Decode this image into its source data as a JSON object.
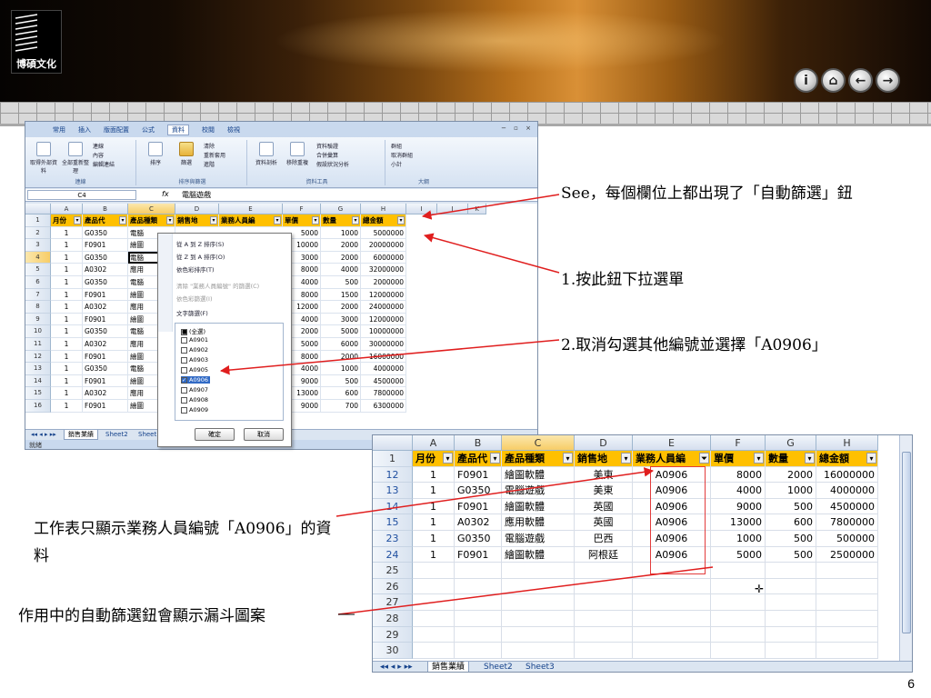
{
  "logo": {
    "text": "博碩文化"
  },
  "nav_buttons": [
    {
      "name": "info-button",
      "glyph": "i"
    },
    {
      "name": "home-button",
      "glyph": "⌂"
    },
    {
      "name": "back-button",
      "glyph": "←"
    },
    {
      "name": "forward-button",
      "glyph": "→"
    }
  ],
  "excel1": {
    "ribbon_tabs": [
      "常用",
      "插入",
      "版面配置",
      "公式",
      "資料",
      "校閱",
      "檢視"
    ],
    "active_tab": "資料",
    "ribbon_groups": [
      {
        "label": "連線",
        "buttons": [
          "取得外部資料",
          "全部重新整理",
          "連線",
          "內容",
          "編輯連結"
        ]
      },
      {
        "label": "排序與篩選",
        "buttons": [
          "排序",
          "篩選",
          "清除",
          "重新套用",
          "進階"
        ]
      },
      {
        "label": "資料工具",
        "buttons": [
          "資料剖析",
          "移除重複",
          "資料驗證",
          "合併彙算",
          "假設狀況分析"
        ]
      },
      {
        "label": "大綱",
        "buttons": [
          "群組",
          "取消群組",
          "小計"
        ]
      }
    ],
    "name_box": "C4",
    "formula_value": "電腦遊戲",
    "columns": [
      "A",
      "B",
      "C",
      "D",
      "E",
      "F",
      "G",
      "H",
      "I",
      "J",
      "K"
    ],
    "header_row": [
      "月份",
      "產品代",
      "產品種類",
      "銷售地",
      "業務人員編",
      "單價",
      "數量",
      "總金額"
    ],
    "rows": [
      {
        "n": "2",
        "a": "1",
        "b": "G0350",
        "c": "電腦",
        "f": "5000",
        "g": "1000",
        "h": "5000000"
      },
      {
        "n": "3",
        "a": "1",
        "b": "F0901",
        "c": "繪圖",
        "f": "10000",
        "g": "2000",
        "h": "20000000"
      },
      {
        "n": "4",
        "a": "1",
        "b": "G0350",
        "c": "電腦",
        "f": "3000",
        "g": "2000",
        "h": "6000000"
      },
      {
        "n": "5",
        "a": "1",
        "b": "A0302",
        "c": "應用",
        "f": "8000",
        "g": "4000",
        "h": "32000000"
      },
      {
        "n": "6",
        "a": "1",
        "b": "G0350",
        "c": "電腦",
        "f": "4000",
        "g": "500",
        "h": "2000000"
      },
      {
        "n": "7",
        "a": "1",
        "b": "F0901",
        "c": "繪圖",
        "f": "8000",
        "g": "1500",
        "h": "12000000"
      },
      {
        "n": "8",
        "a": "1",
        "b": "A0302",
        "c": "應用",
        "f": "12000",
        "g": "2000",
        "h": "24000000"
      },
      {
        "n": "9",
        "a": "1",
        "b": "F0901",
        "c": "繪圖",
        "f": "4000",
        "g": "3000",
        "h": "12000000"
      },
      {
        "n": "10",
        "a": "1",
        "b": "G0350",
        "c": "電腦",
        "f": "2000",
        "g": "5000",
        "h": "10000000"
      },
      {
        "n": "11",
        "a": "1",
        "b": "A0302",
        "c": "應用",
        "f": "5000",
        "g": "6000",
        "h": "30000000"
      },
      {
        "n": "12",
        "a": "1",
        "b": "F0901",
        "c": "繪圖",
        "f": "8000",
        "g": "2000",
        "h": "16000000"
      },
      {
        "n": "13",
        "a": "1",
        "b": "G0350",
        "c": "電腦",
        "f": "4000",
        "g": "1000",
        "h": "4000000"
      },
      {
        "n": "14",
        "a": "1",
        "b": "F0901",
        "c": "繪圖",
        "f": "9000",
        "g": "500",
        "h": "4500000"
      },
      {
        "n": "15",
        "a": "1",
        "b": "A0302",
        "c": "應用",
        "f": "13000",
        "g": "600",
        "h": "7800000"
      },
      {
        "n": "16",
        "a": "1",
        "b": "F0901",
        "c": "繪圖",
        "f": "9000",
        "g": "700",
        "h": "6300000"
      }
    ],
    "dropdown": {
      "sort_asc": "從 A 到 Z 排序(S)",
      "sort_desc": "從 Z 到 A 排序(O)",
      "sort_color": "依色彩排序(T)",
      "clear_filter": "清除 \"業務人員編號\" 的篩選(C)",
      "filter_color": "依色彩篩選(I)",
      "text_filter": "文字篩選(F)",
      "options": [
        {
          "label": "(全選)",
          "state": "partial"
        },
        {
          "label": "A0901",
          "state": "off"
        },
        {
          "label": "A0902",
          "state": "off"
        },
        {
          "label": "A0903",
          "state": "off"
        },
        {
          "label": "A0905",
          "state": "off"
        },
        {
          "label": "A0906",
          "state": "on"
        },
        {
          "label": "A0907",
          "state": "off"
        },
        {
          "label": "A0908",
          "state": "off"
        },
        {
          "label": "A0909",
          "state": "off"
        }
      ],
      "ok": "確定",
      "cancel": "取消"
    },
    "sheet_tabs": [
      "銷售業績",
      "Sheet2",
      "Sheet"
    ],
    "status": "就緒"
  },
  "annotations": {
    "see": "See，每個欄位上都出現了「自動篩選」鈕",
    "step1": "1.按此鈕下拉選單",
    "step2": "2.取消勾選其他編號並選擇「A0906」",
    "result": "工作表只顯示業務人員編號「A0906」的資料",
    "funnel": "作用中的自動篩選鈕會顯示漏斗圖案"
  },
  "excel2": {
    "columns": [
      "A",
      "B",
      "C",
      "D",
      "E",
      "F",
      "G",
      "H"
    ],
    "header_row": [
      "月份",
      "產品代",
      "產品種類",
      "銷售地",
      "業務人員編",
      "單價",
      "數量",
      "總金額"
    ],
    "rows": [
      {
        "n": "12",
        "a": "1",
        "b": "F0901",
        "c": "繪圖軟體",
        "d": "美東",
        "e": "A0906",
        "f": "8000",
        "g": "2000",
        "h": "16000000"
      },
      {
        "n": "13",
        "a": "1",
        "b": "G0350",
        "c": "電腦遊戲",
        "d": "美東",
        "e": "A0906",
        "f": "4000",
        "g": "1000",
        "h": "4000000"
      },
      {
        "n": "14",
        "a": "1",
        "b": "F0901",
        "c": "繪圖軟體",
        "d": "英國",
        "e": "A0906",
        "f": "9000",
        "g": "500",
        "h": "4500000"
      },
      {
        "n": "15",
        "a": "1",
        "b": "A0302",
        "c": "應用軟體",
        "d": "英國",
        "e": "A0906",
        "f": "13000",
        "g": "600",
        "h": "7800000"
      },
      {
        "n": "23",
        "a": "1",
        "b": "G0350",
        "c": "電腦遊戲",
        "d": "巴西",
        "e": "A0906",
        "f": "1000",
        "g": "500",
        "h": "500000"
      },
      {
        "n": "24",
        "a": "1",
        "b": "F0901",
        "c": "繪圖軟體",
        "d": "阿根廷",
        "e": "A0906",
        "f": "5000",
        "g": "500",
        "h": "2500000"
      }
    ],
    "empty_rows": [
      "25",
      "26",
      "27",
      "28",
      "29",
      "30"
    ],
    "sheet_tabs": [
      "銷售業績",
      "Sheet2",
      "Sheet3"
    ]
  },
  "page_number": "6"
}
